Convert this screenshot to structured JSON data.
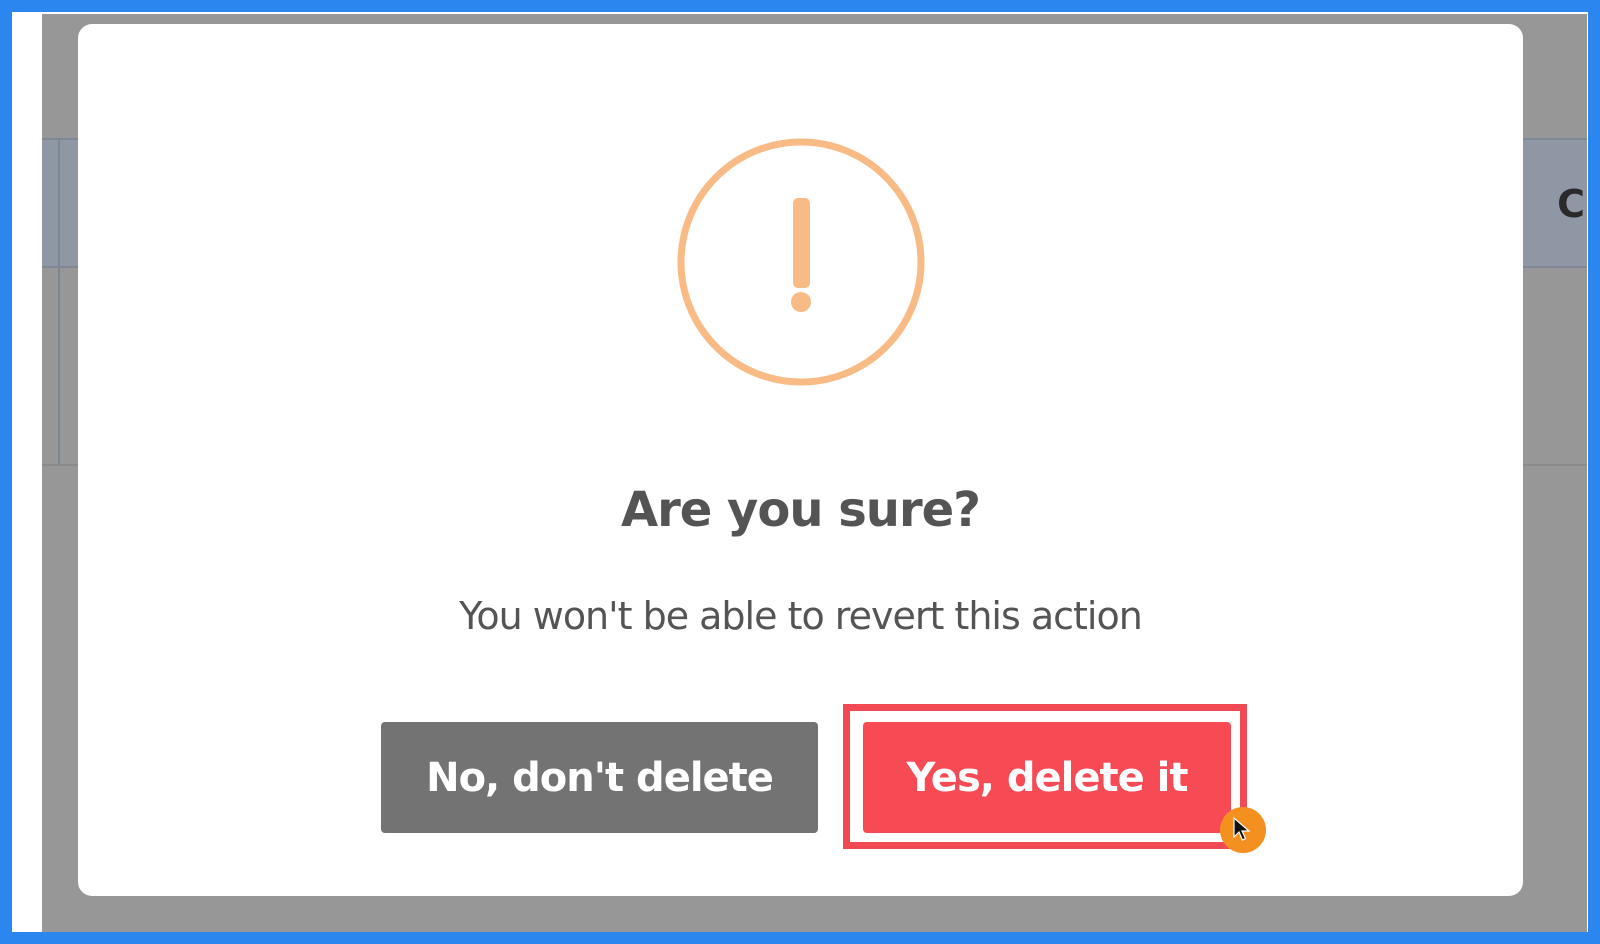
{
  "dialog": {
    "title": "Are you sure?",
    "message": "You won't be able to revert this action",
    "cancel_label": "No, don't delete",
    "confirm_label": "Yes, delete it",
    "icon": "exclamation-warning-icon"
  },
  "background": {
    "partial_text": "C"
  },
  "colors": {
    "warning_icon": "#f8bb86",
    "confirm_button": "#f64a54",
    "cancel_button": "#737373",
    "highlight": "#f24a55",
    "cursor_marker": "#f3901f",
    "frame": "#2b86f0"
  }
}
